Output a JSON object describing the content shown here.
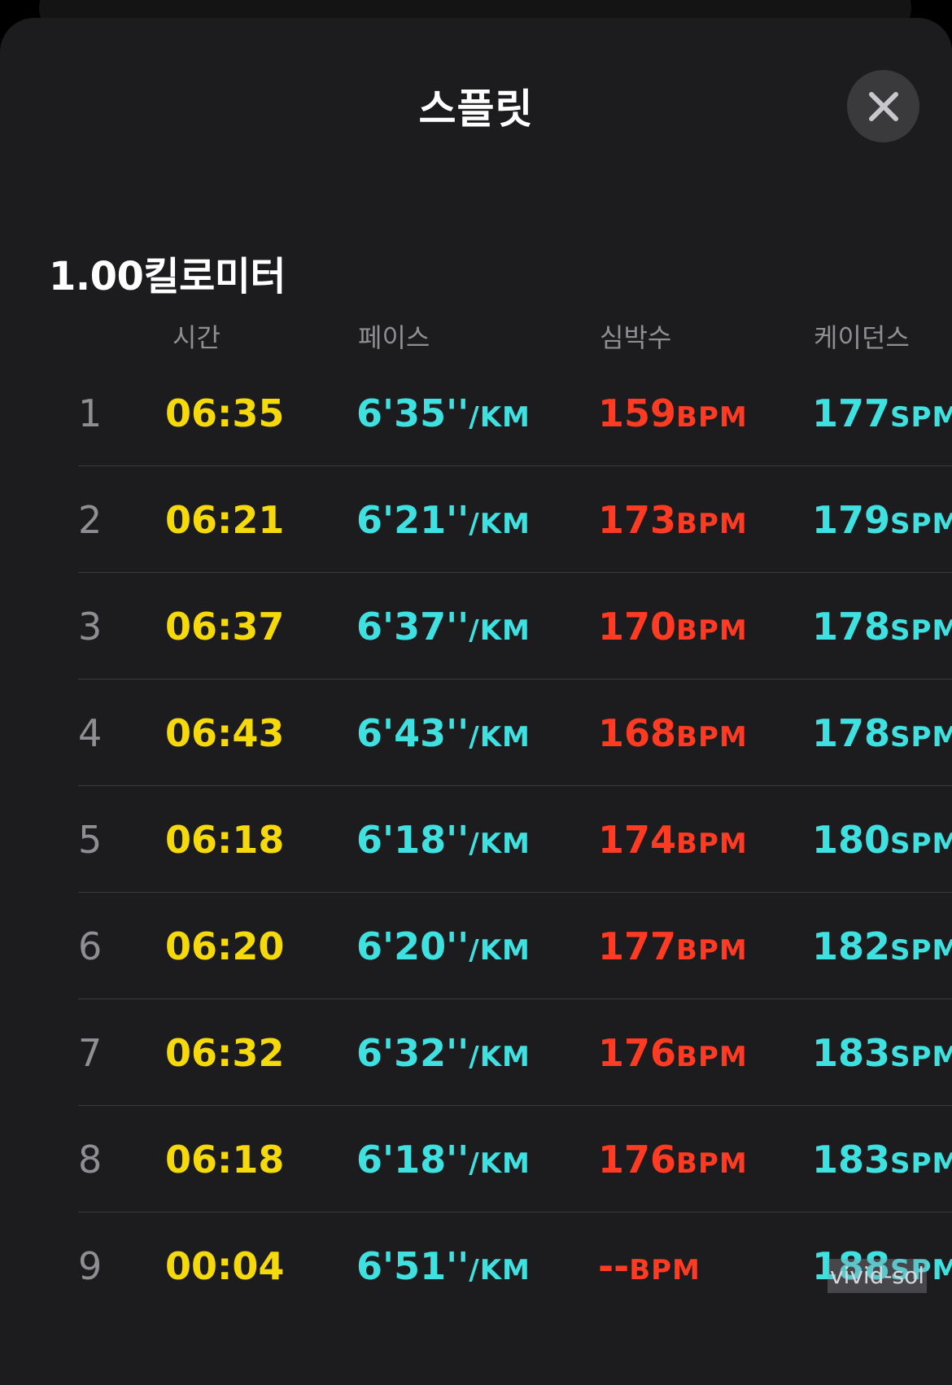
{
  "sheet": {
    "title": "스플릿",
    "close_icon": "close-icon"
  },
  "section": {
    "title": "1.00킬로미터"
  },
  "columns": {
    "time": "시간",
    "pace": "페이스",
    "heart_rate": "심박수",
    "cadence": "케이던스"
  },
  "units": {
    "pace": "/KM",
    "heart_rate": "BPM",
    "cadence": "SPM"
  },
  "splits": [
    {
      "index": "1",
      "time": "06:35",
      "pace": "6'35''",
      "heart_rate": "159",
      "cadence": "177"
    },
    {
      "index": "2",
      "time": "06:21",
      "pace": "6'21''",
      "heart_rate": "173",
      "cadence": "179"
    },
    {
      "index": "3",
      "time": "06:37",
      "pace": "6'37''",
      "heart_rate": "170",
      "cadence": "178"
    },
    {
      "index": "4",
      "time": "06:43",
      "pace": "6'43''",
      "heart_rate": "168",
      "cadence": "178"
    },
    {
      "index": "5",
      "time": "06:18",
      "pace": "6'18''",
      "heart_rate": "174",
      "cadence": "180"
    },
    {
      "index": "6",
      "time": "06:20",
      "pace": "6'20''",
      "heart_rate": "177",
      "cadence": "182"
    },
    {
      "index": "7",
      "time": "06:32",
      "pace": "6'32''",
      "heart_rate": "176",
      "cadence": "183"
    },
    {
      "index": "8",
      "time": "06:18",
      "pace": "6'18''",
      "heart_rate": "176",
      "cadence": "183"
    },
    {
      "index": "9",
      "time": "00:04",
      "pace": "6'51''",
      "heart_rate": "--",
      "cadence": "188"
    }
  ],
  "watermark": "vivid-sol",
  "colors": {
    "background": "#1c1c1e",
    "time": "#f5d90a",
    "pace": "#3fe0e0",
    "heart_rate": "#ff3b23",
    "cadence": "#3fe0e0",
    "label": "#8e8e93"
  }
}
